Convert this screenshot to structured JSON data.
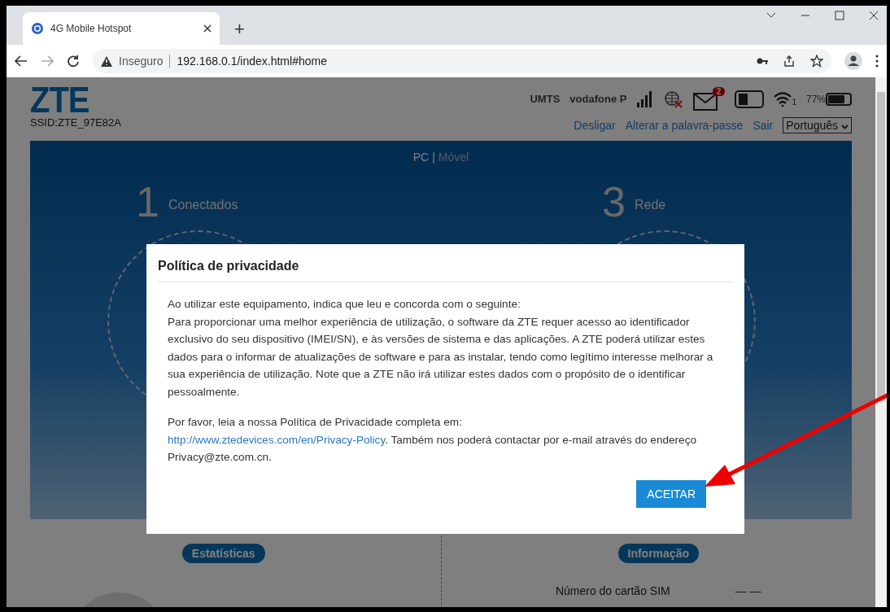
{
  "browser": {
    "tab": {
      "title": "4G Mobile Hotspot",
      "selected": true
    },
    "new_tab": "+",
    "address": {
      "security": "Inseguro",
      "url": "192.168.0.1/index.html#home"
    }
  },
  "header": {
    "logo": "ZTE",
    "ssid": "SSID:ZTE_97E82A",
    "network_type": "UMTS",
    "operator": "vodafone P",
    "sms_count": "2",
    "wifi_clients": "1",
    "battery": "77%",
    "links": [
      "Desligar",
      "Alterar a palavra-passe",
      "Sair"
    ],
    "language": "Português"
  },
  "banner": {
    "view_switch": [
      {
        "label": "PC",
        "selected": true
      },
      {
        "label": "Móvel",
        "selected": false
      }
    ],
    "separator": "|",
    "steps": [
      {
        "number": "1",
        "label": "Conectados"
      },
      {
        "number": "3",
        "label": "Rede"
      }
    ]
  },
  "sections": {
    "statistics": "Estatísticas",
    "information": "Informação",
    "info_rows": [
      {
        "label": "Número do cartão SIM",
        "value": "— —"
      }
    ]
  },
  "modal": {
    "title": "Política de privacidade",
    "intro": "Ao utilizar este equipamento, indica que leu e concorda com o seguinte:",
    "body": "Para proporcionar uma melhor experiência de utilização, o software da ZTE requer acesso ao identificador exclusivo do seu dispositivo (IMEI/SN), e às versões de sistema e das aplicações. A ZTE poderá utilizar estes dados para o informar de atualizações de software e para as instalar, tendo como legítimo interesse melhorar a sua experiência de utilização. Note que a ZTE não irá utilizar estes dados com o propósito de o identificar pessoalmente.",
    "policy_intro": "Por favor, leia a nossa Política de Privacidade completa em:",
    "policy_link": "http://www.ztedevices.com/en/Privacy-Policy",
    "policy_rest": ". Também nos poderá contactar por e-mail através do endereço Privacy@zte.com.cn.",
    "button": "ACEITAR"
  }
}
